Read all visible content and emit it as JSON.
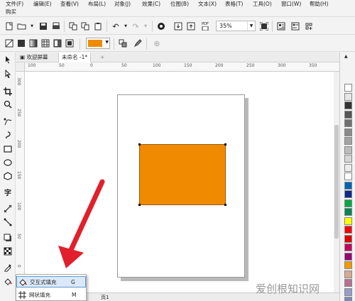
{
  "menu": {
    "row1": [
      "文件(F)",
      "编辑(E)",
      "查看(V)",
      "布局(L)",
      "对象(J)",
      "效果(C)",
      "位图(B)",
      "文本(X)",
      "表格(T)",
      "工具(O)",
      "窗口(W)",
      "帮助(H)"
    ],
    "row2": [
      "购买"
    ]
  },
  "toolbar": {
    "zoom_value": "35%",
    "pdf_label": "PDF"
  },
  "property_bar": {
    "fill_color": "#f08a00"
  },
  "tabs": {
    "welcome": "欢迎屏幕",
    "document": "未命名 -1*",
    "add": "+"
  },
  "ruler": {
    "h_labels": [
      "100",
      "50",
      "0",
      "50",
      "100",
      "150",
      "200",
      "250",
      "300",
      "350"
    ],
    "v_labels": [
      "300",
      "250",
      "200",
      "150",
      "100",
      "50",
      "0"
    ]
  },
  "canvas": {
    "shape_fill": "#f08a00",
    "shape_stroke": "#9a5a00",
    "page_color": "#ffffff"
  },
  "palette": {
    "swatches": [
      "#ffffff",
      "#e6e6e6",
      "#333333",
      "#555555",
      "#707070",
      "#8a8a8a",
      "#a3a3a3",
      "#bdbdbd",
      "#d6d6d6",
      "#ececec",
      "#ffffff",
      "#0066b3",
      "#0a2a8c",
      "#00aa44",
      "#008855",
      "#ffff00",
      "#ff0000",
      "#e00000",
      "#c8005a",
      "#9a0070",
      "#f39800",
      "#d8a890",
      "#b97090",
      "#9a9acb",
      "#7a8ab8",
      "#5a78b0"
    ]
  },
  "flyout": {
    "items": [
      {
        "label": "交互式填充",
        "shortcut": "G",
        "icon": "interactive-fill-icon",
        "selected": true
      },
      {
        "label": "网状填充",
        "shortcut": "M",
        "icon": "mesh-fill-icon",
        "selected": false
      }
    ]
  },
  "status": {
    "page_label": "页1"
  },
  "watermark": "爱创根知识网",
  "colors": {
    "accent_arrow": "#e0202a",
    "selection_highlight": "#dbe8f7"
  }
}
